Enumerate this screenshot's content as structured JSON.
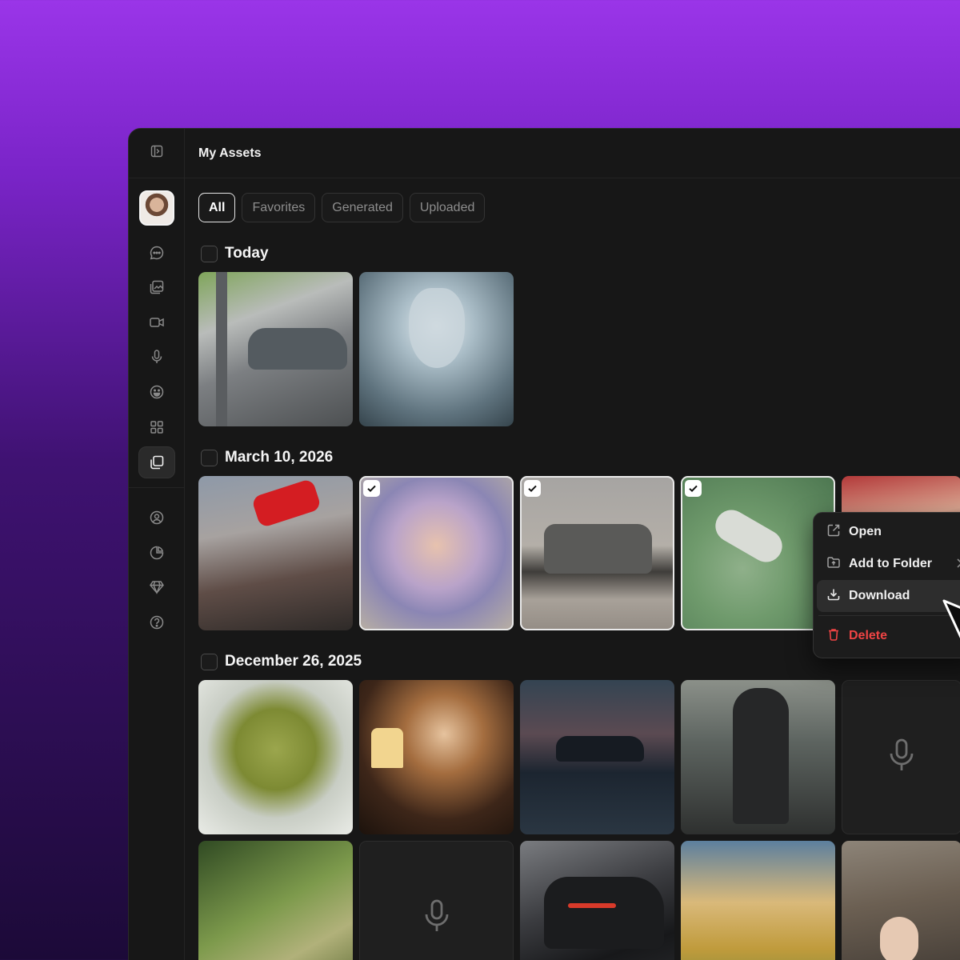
{
  "header": {
    "title": "My Assets"
  },
  "tabs": [
    {
      "label": "All",
      "active": true
    },
    {
      "label": "Favorites",
      "active": false
    },
    {
      "label": "Generated",
      "active": false
    },
    {
      "label": "Uploaded",
      "active": false
    }
  ],
  "sections": [
    {
      "label": "Today"
    },
    {
      "label": "March 10, 2026"
    },
    {
      "label": "December 26, 2025"
    }
  ],
  "context_menu": {
    "items": [
      "Open",
      "Add to Folder",
      "Download",
      "Delete"
    ],
    "hovered": "Download"
  },
  "sidebar": {
    "icons": [
      "panel-toggle-icon",
      "avatar",
      "chat-icon",
      "image-edit-icon",
      "video-icon",
      "microphone-icon",
      "emoji-icon",
      "grid-icon",
      "assets-icon",
      "user-circle-icon",
      "pie-chart-icon",
      "diamond-icon",
      "help-icon"
    ],
    "active": "assets-icon"
  },
  "colors": {
    "accent_bg_top": "#9a35e8",
    "window_bg": "#171717",
    "danger": "#ef4444"
  }
}
